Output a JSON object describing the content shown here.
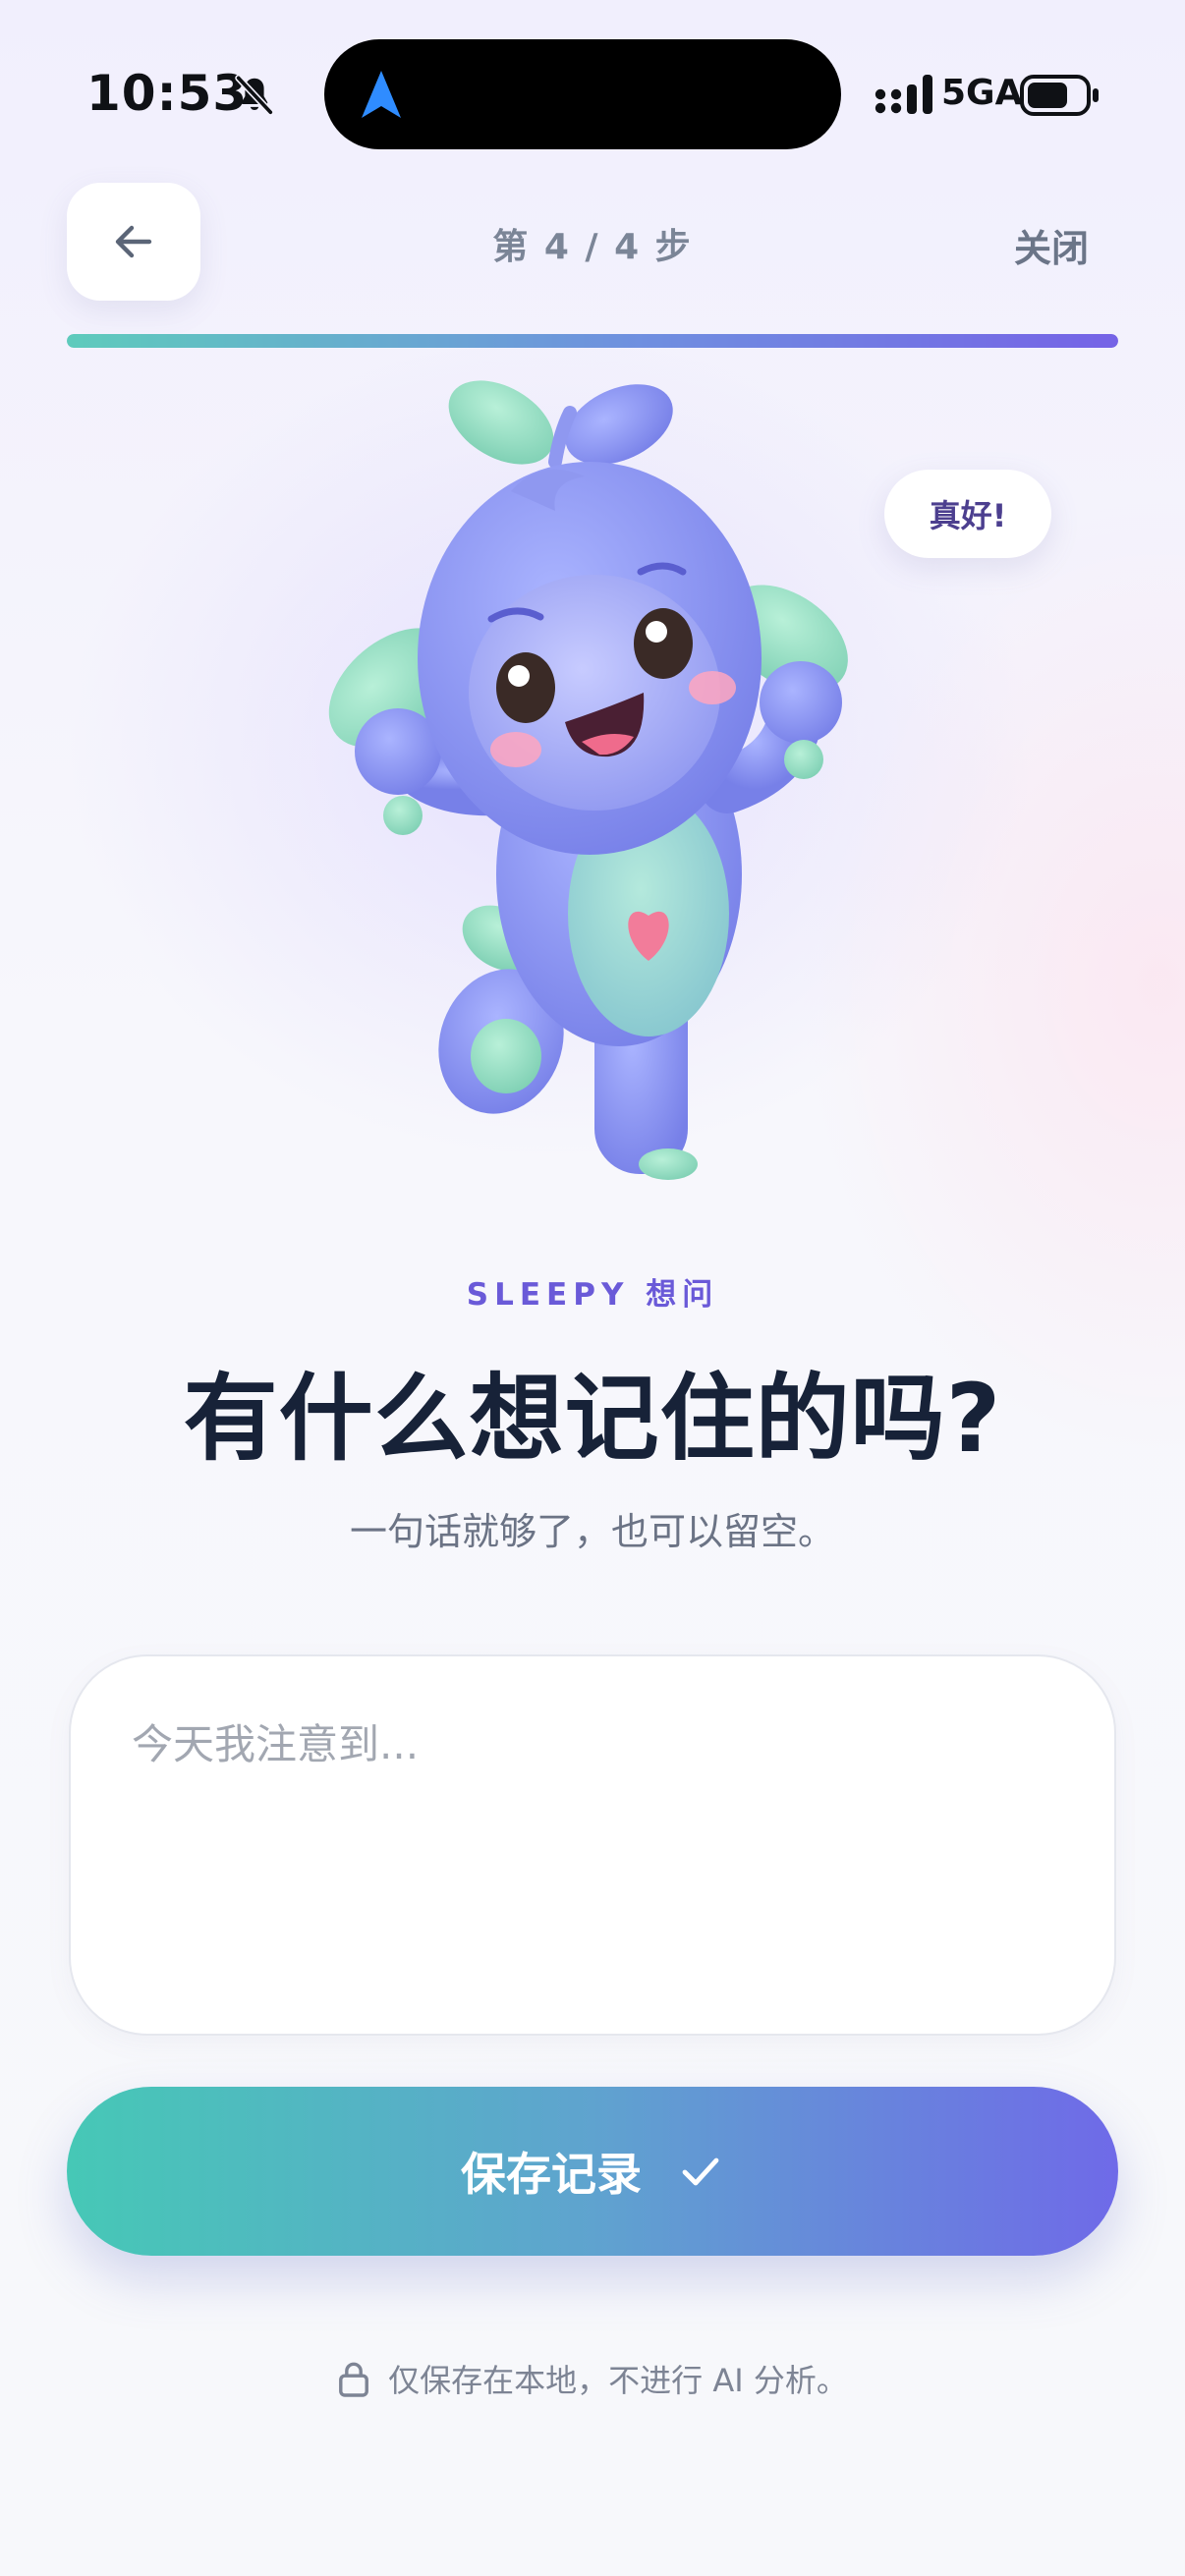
{
  "status_bar": {
    "time": "10:53",
    "network": "5GA",
    "icons": [
      "bell-muted-icon",
      "navigation-arrow-icon",
      "signal-icon",
      "battery-icon"
    ]
  },
  "header": {
    "back_icon": "arrow-left-icon",
    "step_text": "第 4 / 4 步",
    "close_label": "关闭",
    "progress": 1.0
  },
  "mascot": {
    "speech": "真好!"
  },
  "main": {
    "eyebrow": "SLEEPY 想问",
    "title": "有什么想记住的吗?",
    "subtitle": "一句话就够了，也可以留空。",
    "input": {
      "placeholder": "今天我注意到...",
      "value": ""
    },
    "save_label": "保存记录",
    "save_icon": "check-icon"
  },
  "footer": {
    "lock_icon": "lock-icon",
    "privacy_text": "仅保存在本地，不进行 AI 分析。"
  },
  "colors": {
    "accent_purple": "#6a5ad8",
    "title": "#172238",
    "gradient_start": "#46c8b6",
    "gradient_end": "#6f6ae8"
  }
}
